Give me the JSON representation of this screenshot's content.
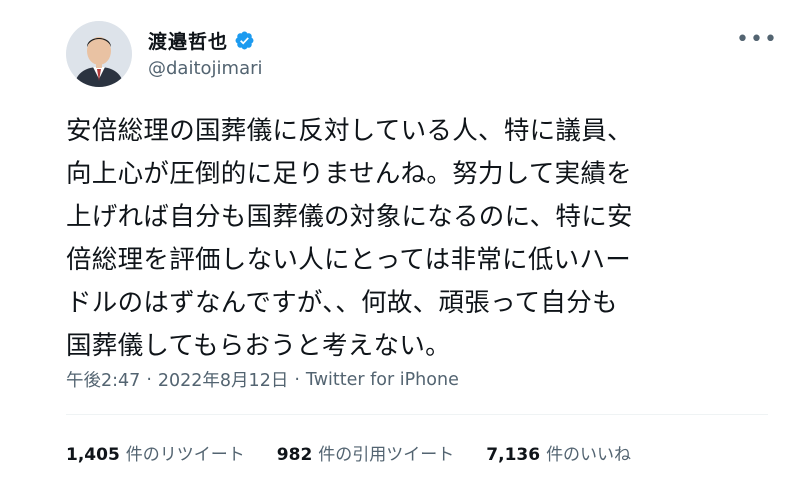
{
  "author": {
    "display_name": "渡邉哲也",
    "handle": "@daitojimari",
    "verified": true
  },
  "tweet": {
    "text": "安倍総理の国葬儀に反対している人、特に議員、\n向上心が圧倒的に足りませんね。努力して実績を\n上げれば自分も国葬儀の対象になるのに、特に安\n倍総理を評価しない人にとっては非常に低いハー\nドルのはずなんですが、、何故、頑張って自分も\n国葬儀してもらおうと考えない。",
    "time": "午後2:47",
    "separator": "·",
    "date": "2022年8月12日",
    "source": "Twitter for iPhone"
  },
  "stats": {
    "retweets": {
      "count": "1,405",
      "label": "件のリツイート"
    },
    "quotes": {
      "count": "982",
      "label": "件の引用ツイート"
    },
    "likes": {
      "count": "7,136",
      "label": "件のいいね"
    }
  },
  "colors": {
    "text": "#0f1419",
    "secondary": "#536471",
    "verified": "#1d9bf0",
    "divider": "#eff3f4"
  },
  "icons": {
    "verified": "verified-badge-icon",
    "more": "more-options-icon"
  }
}
